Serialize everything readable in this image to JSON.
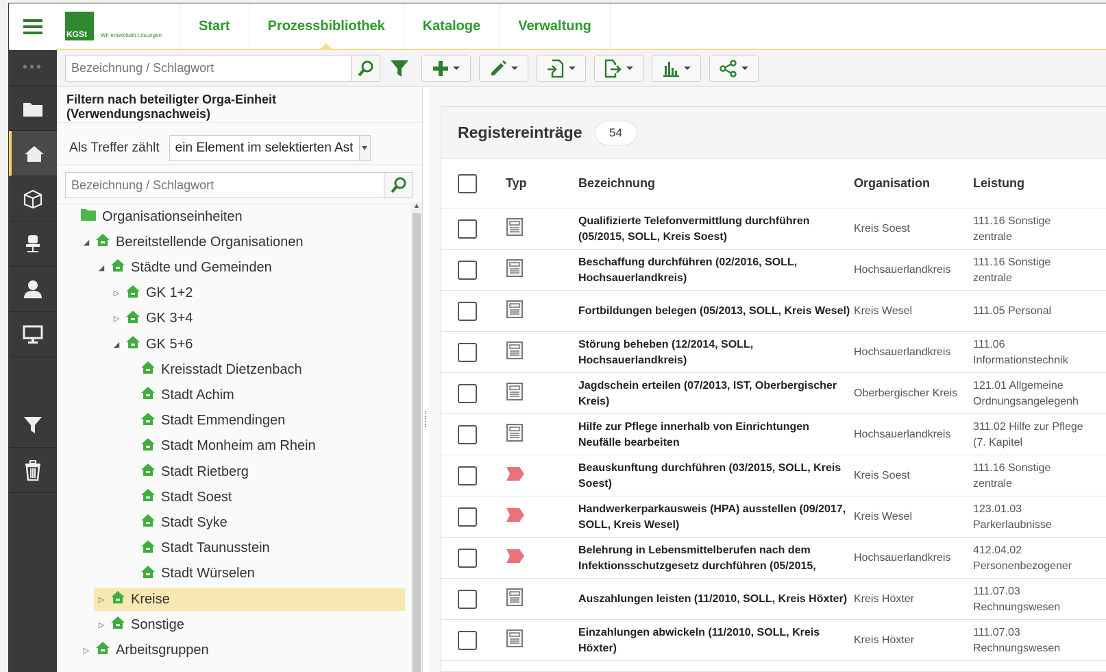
{
  "app": {
    "logo_text": "KGSt",
    "logo_tagline": "Wir entwickeln Lösungen"
  },
  "nav": {
    "tabs": [
      {
        "label": "Start"
      },
      {
        "label": "Prozessbibliothek"
      },
      {
        "label": "Kataloge"
      },
      {
        "label": "Verwaltung"
      }
    ],
    "active_tab": "Prozessbibliothek"
  },
  "toolbar": {
    "search_placeholder": "Bezeichnung / Schlagwort"
  },
  "filter_panel": {
    "heading": "Filtern nach beteiligter Orga-Einheit (Verwendungsnachweis)",
    "match_label": "Als Treffer zählt",
    "match_value": "ein Element im selektierten Ast",
    "search_placeholder": "Bezeichnung / Schlagwort"
  },
  "tree": [
    {
      "label": "Organisationseinheiten",
      "toggle": "",
      "icon": "folder-icon"
    },
    {
      "label": "Bereitstellende Organisationen",
      "toggle": "◢",
      "icon": "house-icon"
    },
    {
      "label": "Städte und Gemeinden",
      "toggle": "◢",
      "icon": "house-icon"
    },
    {
      "label": "GK 1+2",
      "toggle": "▷",
      "icon": "house-icon"
    },
    {
      "label": "GK 3+4",
      "toggle": "▷",
      "icon": "house-icon"
    },
    {
      "label": "GK 5+6",
      "toggle": "◢",
      "icon": "house-icon"
    },
    {
      "label": "Kreisstadt Dietzenbach",
      "toggle": "",
      "icon": "house-icon"
    },
    {
      "label": "Stadt Achim",
      "toggle": "",
      "icon": "house-icon"
    },
    {
      "label": "Stadt Emmendingen",
      "toggle": "",
      "icon": "house-icon"
    },
    {
      "label": "Stadt Monheim am Rhein",
      "toggle": "",
      "icon": "house-icon"
    },
    {
      "label": "Stadt Rietberg",
      "toggle": "",
      "icon": "house-icon"
    },
    {
      "label": "Stadt Soest",
      "toggle": "",
      "icon": "house-icon"
    },
    {
      "label": "Stadt Syke",
      "toggle": "",
      "icon": "house-icon"
    },
    {
      "label": "Stadt Taunusstein",
      "toggle": "",
      "icon": "house-icon"
    },
    {
      "label": "Stadt Würselen",
      "toggle": "",
      "icon": "house-icon"
    },
    {
      "label": "Kreise",
      "toggle": "▷",
      "icon": "house-icon",
      "selected": true
    },
    {
      "label": "Sonstige",
      "toggle": "▷",
      "icon": "house-icon"
    },
    {
      "label": "Arbeitsgruppen",
      "toggle": "▷",
      "icon": "house-icon"
    }
  ],
  "register": {
    "title": "Registereinträge",
    "count": "54",
    "columns": {
      "typ": "Typ",
      "bezeichnung": "Bezeichnung",
      "organisation": "Organisation",
      "leistung": "Leistung"
    },
    "rows": [
      {
        "type": "document",
        "bezeichnung": "Qualifizierte Telefonvermittlung durchführen (05/2015, SOLL, Kreis Soest)",
        "organisation": "Kreis Soest",
        "leistung": "111.16 Sonstige zentrale"
      },
      {
        "type": "document",
        "bezeichnung": "Beschaffung durchführen (02/2016, SOLL, Hochsauerlandkreis)",
        "organisation": "Hochsauerlandkreis",
        "leistung": "111.16 Sonstige zentrale"
      },
      {
        "type": "document",
        "bezeichnung": "Fortbildungen belegen (05/2013, SOLL, Kreis Wesel)",
        "organisation": "Kreis Wesel",
        "leistung": "111.05 Personal"
      },
      {
        "type": "document",
        "bezeichnung": "Störung beheben (12/2014, SOLL, Hochsauerlandkreis)",
        "organisation": "Hochsauerlandkreis",
        "leistung": "111.06 Informationstechnik"
      },
      {
        "type": "document",
        "bezeichnung": "Jagdschein erteilen (07/2013, IST, Oberbergischer Kreis)",
        "organisation": "Oberbergischer Kreis",
        "leistung": "121.01 Allgemeine Ordnungsangelegenh"
      },
      {
        "type": "document",
        "bezeichnung": "Hilfe zur Pflege innerhalb von Einrichtungen Neufälle bearbeiten",
        "organisation": "Hochsauerlandkreis",
        "leistung": "311.02 Hilfe zur Pflege (7. Kapitel"
      },
      {
        "type": "process",
        "bezeichnung": "Beauskunftung durchführen (03/2015, SOLL, Kreis Soest)",
        "organisation": "Kreis Soest",
        "leistung": "111.16 Sonstige zentrale"
      },
      {
        "type": "process",
        "bezeichnung": "Handwerkerparkausweis (HPA) ausstellen (09/2017, SOLL, Kreis Wesel)",
        "organisation": "Kreis Wesel",
        "leistung": "123.01.03 Parkerlaubnisse"
      },
      {
        "type": "process",
        "bezeichnung": "Belehrung in Lebensmittelberufen nach dem Infektionsschutzgesetz durchführen (05/2015,",
        "organisation": "Hochsauerlandkreis",
        "leistung": "412.04.02 Personenbezogener"
      },
      {
        "type": "document",
        "bezeichnung": "Auszahlungen leisten (11/2010, SOLL, Kreis Höxter)",
        "organisation": "Kreis Höxter",
        "leistung": "111.07.03 Rechnungswesen"
      },
      {
        "type": "document",
        "bezeichnung": "Einzahlungen abwickeln (11/2010, SOLL, Kreis Höxter)",
        "organisation": "Kreis Höxter",
        "leistung": "111.07.03 Rechnungswesen"
      }
    ]
  },
  "colors": {
    "brand_green": "#2e9a2e",
    "highlight_yellow": "#f8e9b3",
    "process_red": "#e8737d",
    "rail_dark": "#3a3a3a"
  }
}
